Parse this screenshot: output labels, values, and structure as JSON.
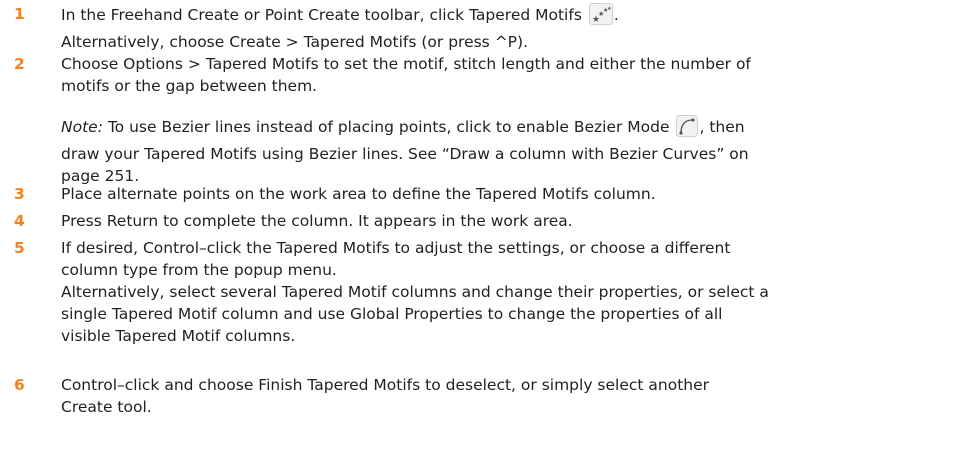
{
  "colors": {
    "step_number": "#f58220",
    "text": "#231f20"
  },
  "steps": [
    {
      "number": "1",
      "line1_before": "In the Freehand Create or Point Create toolbar, click Tapered Motifs",
      "line1_icon": "tapered-motifs-icon",
      "line1_after": ".",
      "line2": "Alternatively, choose Create > Tapered Motifs (or press ^P)."
    },
    {
      "number": "2",
      "line1": "Choose Options > Tapered Motifs to set the motif, stitch length and either the number of",
      "line2": "motifs or the gap between them."
    },
    {
      "number": "3",
      "line1": "Place alternate points on the work area to define the Tapered Motifs column."
    },
    {
      "number": "4",
      "line1": "Press Return to complete the column. It appears in the work area."
    },
    {
      "number": "5",
      "line1": "If desired, Control–click the Tapered Motifs to adjust the settings, or choose a different",
      "line2": "column type from the popup menu.",
      "line3": "Alternatively, select several Tapered Motif columns and change their properties, or select a",
      "line4": "single Tapered Motif column and use Global Properties to change the properties of all",
      "line5": "visible Tapered Motif columns."
    },
    {
      "number": "6",
      "line1": "Control–click and choose Finish Tapered Motifs to deselect, or simply select another",
      "line2": "Create tool."
    }
  ],
  "note": {
    "label": "Note:",
    "line1_before": " To use Bezier lines instead of placing points, click to enable Bezier Mode",
    "line1_icon": "bezier-mode-icon",
    "line1_after": ", then",
    "line2": "draw your Tapered Motifs using Bezier lines. See “Draw a column with Bezier Curves” on",
    "line3": "page 251."
  }
}
